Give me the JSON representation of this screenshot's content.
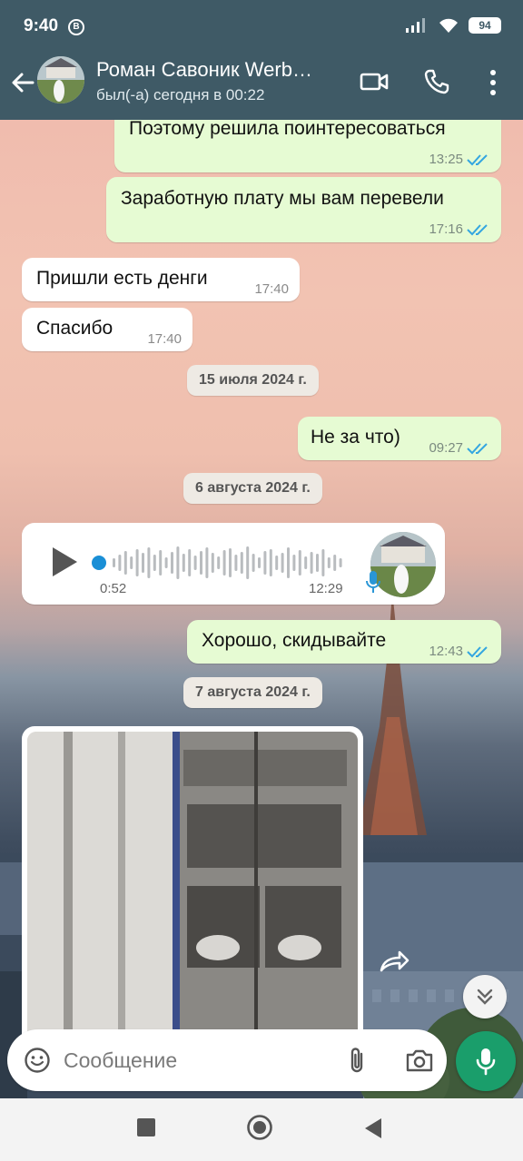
{
  "status_bar": {
    "time": "9:40",
    "b_badge": "B",
    "battery": "94"
  },
  "header": {
    "contact_name": "Роман Савоник Werb…",
    "contact_status": "был(-а) сегодня в 00:22",
    "icons": [
      "back-arrow-icon",
      "video-call-icon",
      "phone-icon",
      "more-vert-icon"
    ]
  },
  "messages": [
    {
      "type": "out",
      "text": "Поэтому решила поинтересоваться",
      "time": "13:25",
      "read": true
    },
    {
      "type": "out",
      "text": "Заработную плату мы вам перевели",
      "time": "17:16",
      "read": true
    },
    {
      "type": "in",
      "text": "Пришли есть денги",
      "time": "17:40"
    },
    {
      "type": "in",
      "text": "Спасибо",
      "time": "17:40"
    },
    {
      "type": "date",
      "text": "15 июля 2024 г."
    },
    {
      "type": "out",
      "text": "Не за что)",
      "time": "09:27",
      "read": true
    },
    {
      "type": "date",
      "text": "6 августа 2024 г."
    },
    {
      "type": "voice",
      "duration": "0:52",
      "time": "12:29"
    },
    {
      "type": "out",
      "text": "Хорошо, скидывайте",
      "time": "12:43",
      "read": true
    },
    {
      "type": "date",
      "text": "7 августа 2024 г."
    },
    {
      "type": "image"
    }
  ],
  "composer": {
    "placeholder": "Сообщение"
  },
  "colors": {
    "header_bg": "#3f5a66",
    "outgoing_bubble": "#e6fbd3",
    "incoming_bubble": "#ffffff",
    "read_ticks": "#34a6e0",
    "mic_button": "#1a9e6b"
  }
}
